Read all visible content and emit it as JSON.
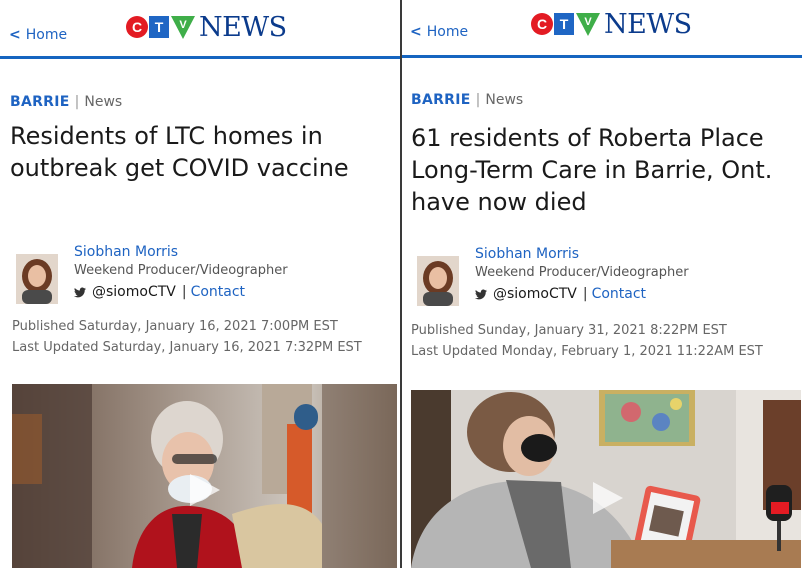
{
  "left": {
    "home_label": "Home",
    "logo_text": "NEWS",
    "section": "BARRIE",
    "section_sub": "News",
    "headline": "Residents of LTC homes in outbreak get COVID vaccine",
    "author_name": "Siobhan Morris",
    "author_role": "Weekend Producer/Videographer",
    "author_handle": "@siomoCTV",
    "contact_label": "Contact",
    "published": "Published Saturday, January 16, 2021 7:00PM EST",
    "updated": "Last Updated Saturday, January 16, 2021 7:32PM EST"
  },
  "right": {
    "home_label": "Home",
    "logo_text": "NEWS",
    "section": "BARRIE",
    "section_sub": "News",
    "headline": "61 residents of Roberta Place Long-Term Care in Barrie, Ont. have now died",
    "author_name": "Siobhan Morris",
    "author_role": "Weekend Producer/Videographer",
    "author_handle": "@siomoCTV",
    "contact_label": "Contact",
    "published": "Published Sunday, January 31, 2021 8:22PM EST",
    "updated": "Last Updated Monday, February 1, 2021 11:22AM EST"
  },
  "colors": {
    "link_blue": "#1e63c2",
    "ctv_red": "#e31b23",
    "ctv_blue": "#1f66c4",
    "ctv_green": "#3fae49",
    "news_blue": "#0b3b8c"
  },
  "icons": [
    "chevron-left-icon",
    "ctv-logo",
    "twitter-icon",
    "play-icon"
  ]
}
